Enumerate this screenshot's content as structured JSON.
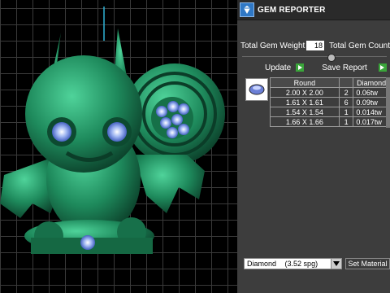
{
  "panel": {
    "title": "GEM REPORTER",
    "total_weight_label": "Total Gem Weight",
    "total_weight_value": "18",
    "total_count_label": "Total Gem Count",
    "update_label": "Update",
    "save_report_label": "Save Report"
  },
  "table": {
    "headers": [
      "Round",
      "",
      "Diamond"
    ],
    "rows": [
      {
        "size": "2.00 X 2.00",
        "qty": "2",
        "carat": "0.06tw"
      },
      {
        "size": "1.61 X 1.61",
        "qty": "6",
        "carat": "0.09tw"
      },
      {
        "size": "1.54 X 1.54",
        "qty": "1",
        "carat": "0.014tw"
      },
      {
        "size": "1.66 X 1.66",
        "qty": "1",
        "carat": "0.017tw"
      }
    ]
  },
  "material": {
    "selected": "Diamond",
    "spg": "(3.52 spg)",
    "set_label": "Set Material"
  },
  "colors": {
    "model": "#1e8a5c",
    "gem": "#7a9ce8",
    "panel_bg": "#3d3d3d",
    "accent_play": "#3aa53a"
  },
  "icons": [
    "gem-reporter-icon",
    "play-icon",
    "dropdown-arrow-icon",
    "gem-thumbnail-icon"
  ]
}
